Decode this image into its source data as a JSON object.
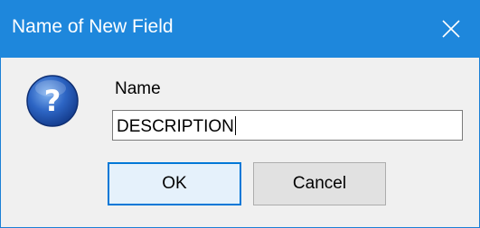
{
  "dialog": {
    "title": "Name of New Field",
    "close_icon": "close-icon",
    "prompt_icon": "question-icon",
    "field_label": "Name",
    "field_value": "DESCRIPTION",
    "ok_label": "OK",
    "cancel_label": "Cancel"
  },
  "colors": {
    "titlebar": "#1e87dc",
    "dialog_background": "#f0f0f0",
    "default_button_border": "#0078d7"
  }
}
